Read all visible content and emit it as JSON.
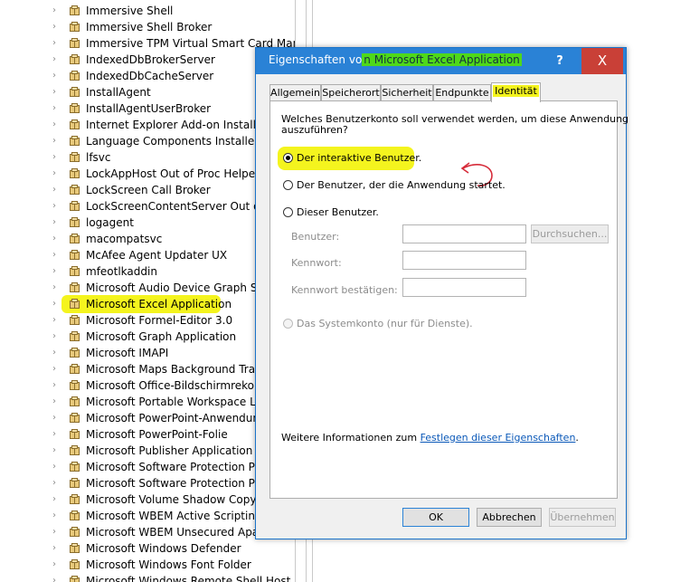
{
  "tree": {
    "items": [
      "Immersive Shell",
      "Immersive Shell Broker",
      "Immersive TPM Virtual Smart Card Manager",
      "IndexedDbBrokerServer",
      "IndexedDbCacheServer",
      "InstallAgent",
      "InstallAgentUserBroker",
      "Internet Explorer Add-on Installer",
      "Language Components Installer Com",
      "lfsvc",
      "LockAppHost Out of Proc Helper fo",
      "LockScreen Call Broker",
      "LockScreenContentServer Out of Pr",
      "logagent",
      "macompatsvc",
      "McAfee Agent Updater UX",
      "mfeotlkaddin",
      "Microsoft Audio Device Graph Serve",
      "Microsoft Excel Application",
      "Microsoft Formel-Editor 3.0",
      "Microsoft Graph Application",
      "Microsoft IMAPI",
      "Microsoft Maps Background Transf",
      "Microsoft Office-Bildschirmrekorde",
      "Microsoft Portable Workspace Laun",
      "Microsoft PowerPoint-Anwendung",
      "Microsoft PowerPoint-Folie",
      "Microsoft Publisher Application",
      "Microsoft Software Protection Platf",
      "Microsoft Software Protection Platf",
      "Microsoft Volume Shadow Copy Se",
      "Microsoft WBEM Active Scripting Ev",
      "Microsoft WBEM Unsecured Apartm",
      "Microsoft Windows Defender",
      "Microsoft Windows Font Folder",
      "Microsoft Windows Remote Shell Host"
    ],
    "highlighted_item": "Microsoft Excel Application"
  },
  "dialog": {
    "title_prefix": "Eigenschaften vo",
    "title_highlight": "n Microsoft Excel Application",
    "help_label": "?",
    "close_label": "X",
    "tabs": [
      "Allgemein",
      "Speicherort",
      "Sicherheit",
      "Endpunkte",
      "Identität"
    ],
    "active_tab": "Identität",
    "question_line1": "Welches Benutzerkonto soll verwendet werden, um diese Anwendung",
    "question_line2": "auszuführen?",
    "options": {
      "interactive": "Der interaktive Benutzer.",
      "launching": "Der Benutzer, der die Anwendung startet.",
      "this_user": "Dieser Benutzer.",
      "system": "Das Systemkonto (nur für Dienste)."
    },
    "selected_option": "interactive",
    "fields": {
      "user_label": "Benutzer:",
      "password_label": "Kennwort:",
      "confirm_label": "Kennwort bestätigen:",
      "user_value": "",
      "password_value": "",
      "confirm_value": ""
    },
    "browse_label": "Durchsuchen...",
    "more_info_prefix": "Weitere Informationen zum ",
    "more_info_link": "Festlegen dieser Eigenschaften",
    "more_info_suffix": ".",
    "buttons": {
      "ok": "OK",
      "cancel": "Abbrechen",
      "apply": "Übernehmen"
    },
    "annotation_color": "#d62c3a",
    "highlight_color": "#f4f41e"
  }
}
